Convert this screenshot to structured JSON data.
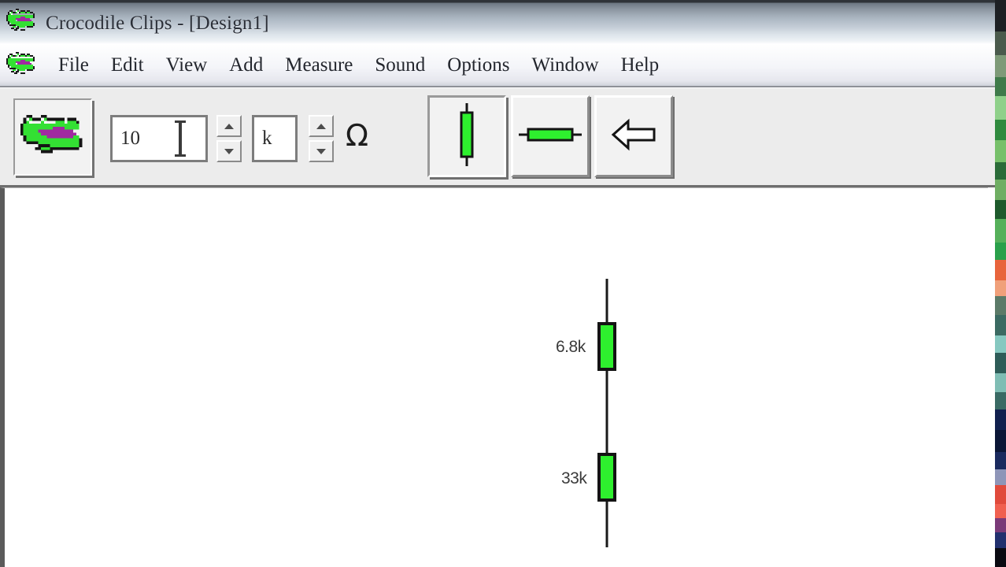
{
  "window": {
    "title": "Crocodile Clips - [Design1]",
    "app_icon": "crocodile-icon"
  },
  "menubar": {
    "app_icon": "crocodile-icon",
    "items": [
      {
        "label": "File"
      },
      {
        "label": "Edit"
      },
      {
        "label": "View"
      },
      {
        "label": "Add"
      },
      {
        "label": "Measure"
      },
      {
        "label": "Sound"
      },
      {
        "label": "Options"
      },
      {
        "label": "Window"
      },
      {
        "label": "Help"
      }
    ]
  },
  "toolbar": {
    "croc_button_icon": "crocodile-icon",
    "value_input": {
      "value": "10",
      "placeholder": ""
    },
    "value_spinner": {
      "up": "▲",
      "down": "▼"
    },
    "unit_input": {
      "value": "k",
      "placeholder": ""
    },
    "unit_spinner": {
      "up": "▲",
      "down": "▼"
    },
    "units_symbol": "Ω",
    "buttons": [
      {
        "name": "vertical-resistor-button",
        "icon": "resistor-vertical-icon",
        "state": "pressed"
      },
      {
        "name": "horizontal-resistor-button",
        "icon": "resistor-horizontal-icon",
        "state": "raised"
      },
      {
        "name": "back-arrow-button",
        "icon": "arrow-left-icon",
        "state": "raised"
      }
    ]
  },
  "canvas": {
    "components": [
      {
        "type": "resistor",
        "orientation": "vertical",
        "label": "6.8k"
      },
      {
        "type": "resistor",
        "orientation": "vertical",
        "label": "33k"
      }
    ]
  },
  "colors": {
    "component_green": "#2ef02e",
    "component_outline": "#141414",
    "wire": "#1a1a1a",
    "toolbar_bg": "#ececec",
    "title_text": "#2b2f38",
    "croc_body": "#33e033",
    "croc_mouth": "#a02aa0"
  }
}
